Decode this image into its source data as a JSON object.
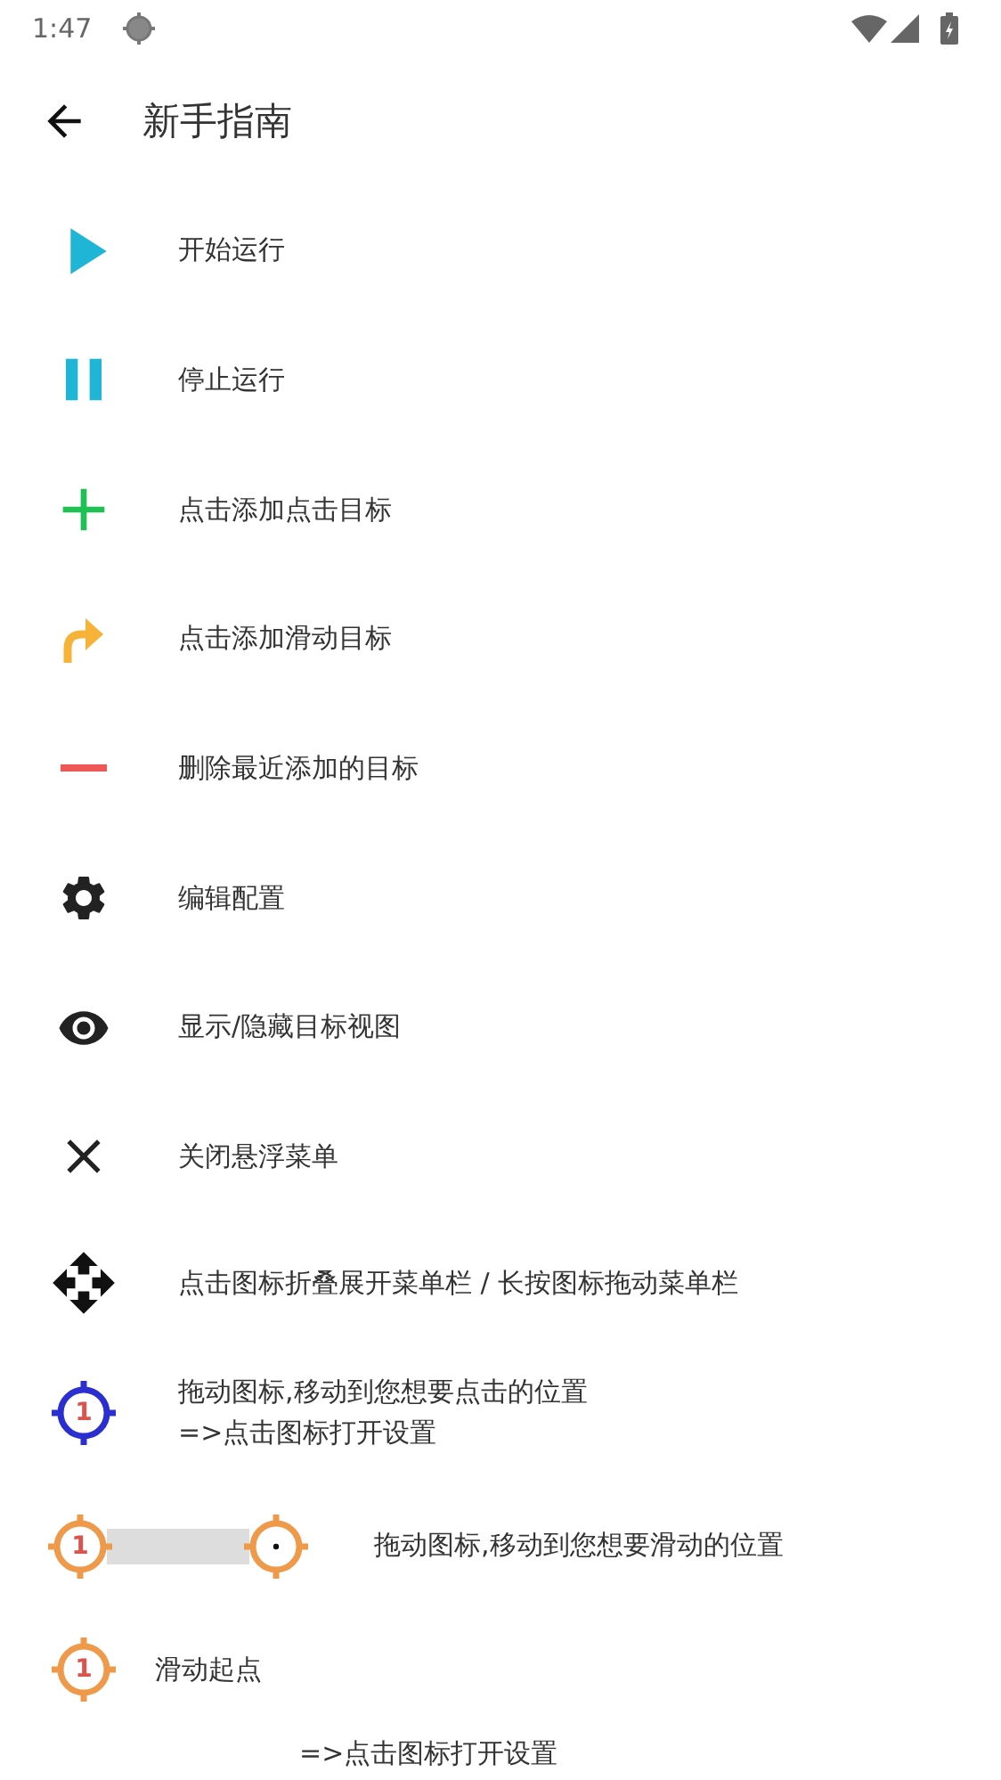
{
  "status_bar": {
    "time": "1:47"
  },
  "header": {
    "title": "新手指南"
  },
  "items": [
    {
      "kind": "play",
      "label": "开始运行"
    },
    {
      "kind": "pause",
      "label": "停止运行"
    },
    {
      "kind": "plus",
      "label": "点击添加点击目标"
    },
    {
      "kind": "swipe",
      "label": "点击添加滑动目标"
    },
    {
      "kind": "minus",
      "label": "删除最近添加的目标"
    },
    {
      "kind": "gear",
      "label": "编辑配置"
    },
    {
      "kind": "eye",
      "label": "显示/隐藏目标视图"
    },
    {
      "kind": "close",
      "label": "关闭悬浮菜单"
    },
    {
      "kind": "move",
      "label": "点击图标折叠展开菜单栏 / 长按图标拖动菜单栏"
    },
    {
      "kind": "click-target",
      "badge": "1",
      "lines": [
        "拖动图标,移动到您想要点击的位置",
        "=>点击图标打开设置"
      ]
    },
    {
      "kind": "swipe-target",
      "badge": "1",
      "label": "拖动图标,移动到您想要滑动的位置"
    },
    {
      "kind": "swipe-start",
      "badge": "1",
      "label": "滑动起点",
      "note": "=>点击图标打开设置"
    }
  ]
}
